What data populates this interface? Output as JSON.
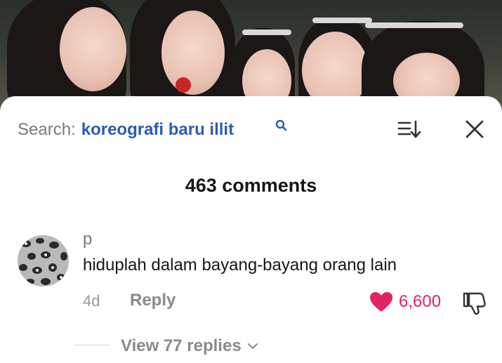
{
  "search": {
    "label": "Search:",
    "query": "koreografi baru illit"
  },
  "comments_header": {
    "count_text": "463 comments"
  },
  "comment": {
    "username": "p",
    "text": "hiduplah dalam bayang-bayang orang lain",
    "age": "4d",
    "reply_label": "Reply",
    "like_count": "6,600",
    "view_replies": "View 77 replies"
  },
  "icons": {
    "search": "search-icon",
    "sort": "sort-icon",
    "close": "close-icon",
    "like": "heart-icon",
    "dislike": "thumbs-down-icon",
    "expand": "chevron-down-icon"
  },
  "colors": {
    "query": "#2a5db0",
    "like": "#e0245e",
    "muted": "#8a8a8a"
  }
}
